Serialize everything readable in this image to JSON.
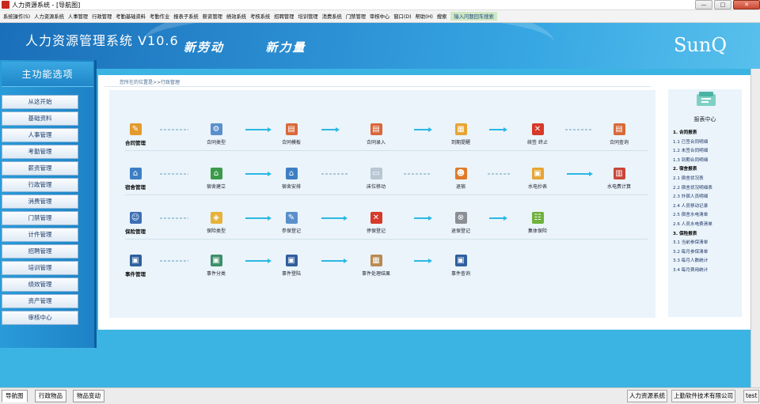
{
  "window": {
    "title": "人力资源系统 - [导航图]",
    "controls": {
      "minimize": "—",
      "maximize": "□",
      "close": "✕"
    }
  },
  "menubar": {
    "items": [
      "系统操作(S)",
      "人力资源系统",
      "人事管理",
      "行政管理",
      "考勤基础资料",
      "考勤作业",
      "报表子系统",
      "薪资管理",
      "绩效系统",
      "考核系统",
      "招聘管理",
      "培训管理",
      "消费系统",
      "门禁管理",
      "审核中心",
      "窗口(D)",
      "帮助(H)",
      "搜索"
    ],
    "search_placeholder": "输入问题回车搜索"
  },
  "header": {
    "title": "人力资源管理系统 V10.6",
    "slogan_1": "新劳动",
    "slogan_2": "新力量",
    "brand": "SunQ"
  },
  "sidebar": {
    "title": "主功能选项",
    "items": [
      "从这开始",
      "基础资料",
      "人事管理",
      "考勤管理",
      "薪资管理",
      "行政管理",
      "消费管理",
      "门禁管理",
      "计件管理",
      "招聘管理",
      "培训管理",
      "绩效管理",
      "资产管理",
      "审核中心"
    ]
  },
  "main": {
    "breadcrumb": "您所在的位置是>>行政管理",
    "rows": [
      {
        "head": "合同管理",
        "steps": [
          "合同类型",
          "合同模板",
          "合同录入",
          "到期提醒",
          "续签 终止",
          "合同查询"
        ]
      },
      {
        "head": "宿舍管理",
        "steps": [
          "宿舍建立",
          "宿舍安排",
          "床位移动",
          "退宿",
          "水电抄表",
          "水电费计算"
        ]
      },
      {
        "head": "保险管理",
        "steps": [
          "保险类型",
          "参保登记",
          "停保登记",
          "退保登记",
          "集体保险"
        ]
      },
      {
        "head": "事件管理",
        "steps": [
          "事件分类",
          "事件登陆",
          "事件处理结果",
          "事件查询"
        ]
      }
    ]
  },
  "report": {
    "title": "报表中心",
    "lines": [
      {
        "text": "1. 合同报表",
        "section": true
      },
      {
        "text": "1.1 已签合同明细",
        "section": false
      },
      {
        "text": "1.2 未签合同明细",
        "section": false
      },
      {
        "text": "1.3 到期合同明细",
        "section": false
      },
      {
        "text": "2. 宿舍报表",
        "section": true
      },
      {
        "text": "2.1 宿舍状况表",
        "section": false
      },
      {
        "text": "2.2 宿舍状况明细表",
        "section": false
      },
      {
        "text": "2.3 外宿人员明细",
        "section": false
      },
      {
        "text": "2.4 人员移动记录",
        "section": false
      },
      {
        "text": "2.5 宿舍水电清单",
        "section": false
      },
      {
        "text": "2.6 人员水电费清单",
        "section": false
      },
      {
        "text": "3. 保险报表",
        "section": true
      },
      {
        "text": "3.1 当前参保清单",
        "section": false
      },
      {
        "text": "3.2 每月参保清单",
        "section": false
      },
      {
        "text": "3.3 每月人数统计",
        "section": false
      },
      {
        "text": "3.4 每月费用统计",
        "section": false
      }
    ]
  },
  "statusbar": {
    "tabs": [
      "导航图",
      "行政物品",
      "物品变动"
    ],
    "cells": [
      "人力资源系统",
      "上勤软件技术有限公司",
      "test"
    ]
  },
  "colors": {
    "header_blue": "#2b8ed2",
    "sidebar_blue": "#1d82c6",
    "flow_arrow": "#2bb8e4",
    "flow_background": "#eaf4fa"
  },
  "icons": {
    "contract": "contract-icon",
    "dorm": "dorm-icon",
    "insurance": "insurance-icon",
    "event": "event-icon",
    "report": "report-center-icon"
  }
}
